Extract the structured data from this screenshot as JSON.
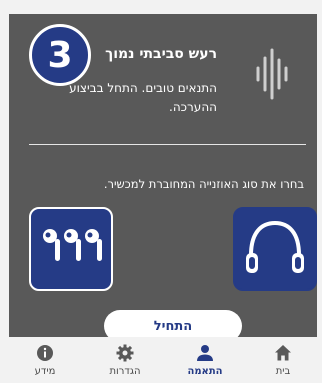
{
  "step": {
    "number": "3"
  },
  "card": {
    "title": "רעש סביבתי נמוך",
    "description": "התנאים טובים. התחל בביצוע ההערכה."
  },
  "device_prompt": "בחרו את סוג האוזנייה המחוברת למכשיר.",
  "device_options": [
    {
      "name": "earbuds",
      "icon": "earbuds-icon",
      "selected": true
    },
    {
      "name": "headphones",
      "icon": "headphones-icon",
      "selected": false
    }
  ],
  "start_button": {
    "label": "התחיל"
  },
  "tabs": [
    {
      "label": "מידע",
      "icon": "info-icon",
      "active": false
    },
    {
      "label": "הגדרות",
      "icon": "gear-icon",
      "active": false
    },
    {
      "label": "התאמה",
      "icon": "person-icon",
      "active": true
    },
    {
      "label": "בית",
      "icon": "home-icon",
      "active": false
    }
  ],
  "colors": {
    "panel": "#595959",
    "accent": "#253b86",
    "active_tab": "#253b86"
  }
}
